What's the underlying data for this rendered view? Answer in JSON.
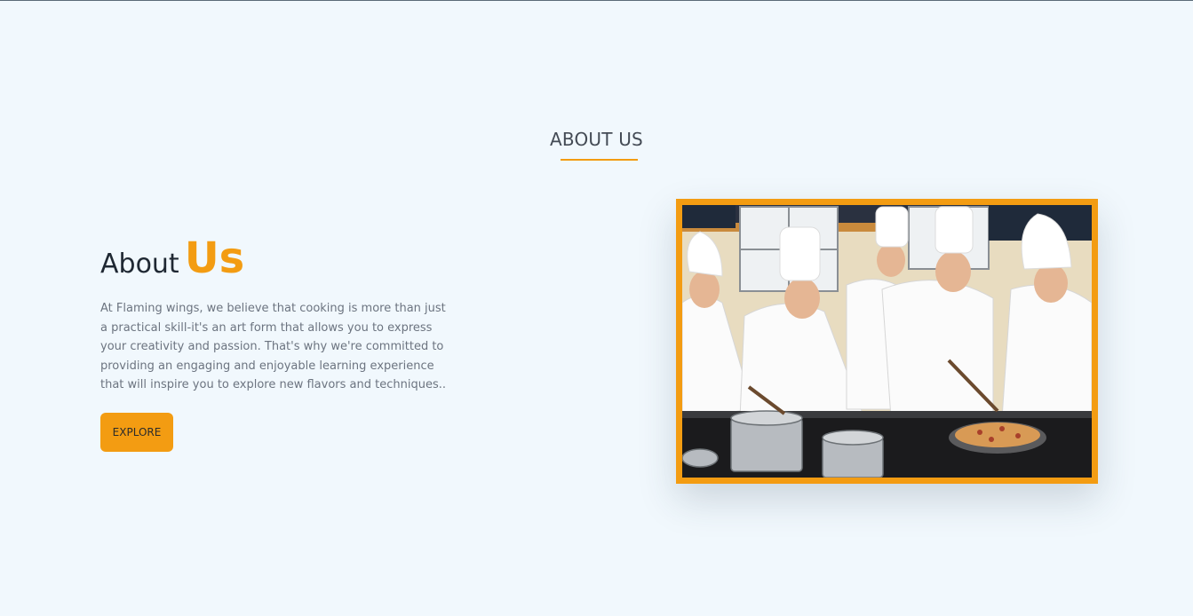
{
  "section": {
    "title": "ABOUT US"
  },
  "about": {
    "heading_word1": "About",
    "heading_word2": "Us",
    "body": "At Flaming wings, we believe that cooking is more than just a practical skill-it's an art form that allows you to express your creativity and passion. That's why we're committed to providing an engaging and enjoyable learning experience that will inspire you to explore new flavors and techniques..",
    "button_label": "EXPLORE"
  },
  "colors": {
    "accent": "#f39c12",
    "background": "#f1f8fd",
    "heading": "#1f2833",
    "body_text": "#6c7480"
  },
  "image": {
    "subject": "chefs-cooking-photo"
  }
}
